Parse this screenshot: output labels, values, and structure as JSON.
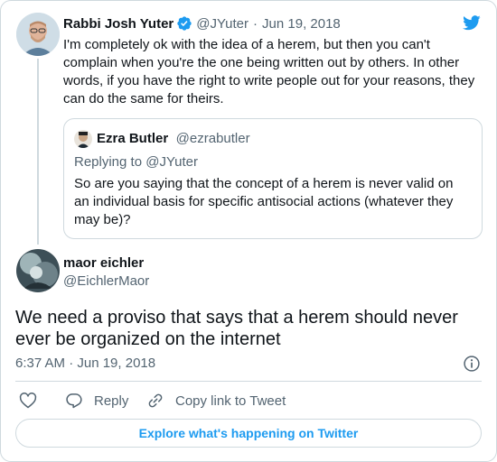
{
  "parent_tweet": {
    "author_name": "Rabbi Josh Yuter",
    "handle": "@JYuter",
    "separator": "·",
    "date": "Jun 19, 2018",
    "text": "I'm completely ok with the idea of a herem, but then you can't complain when you're the one being written out by others. In other words, if you have the right to write people out for your reasons, they can do the same for theirs."
  },
  "quoted_tweet": {
    "author_name": "Ezra Butler",
    "handle": "@ezrabutler",
    "replying_to": "Replying to @JYuter",
    "text": "So are you saying that the concept of a herem is never valid on an individual basis for specific antisocial actions (whatever they may be)?"
  },
  "main_tweet": {
    "author_name": "maor eichler",
    "handle": "@EichlerMaor",
    "text": "We need a proviso that says that a herem should never ever be organized on the internet",
    "timestamp": "6:37 AM · Jun 19, 2018"
  },
  "actions": {
    "reply_label": "Reply",
    "copy_label": "Copy link to Tweet"
  },
  "footer": {
    "explore_label": "Explore what's happening on Twitter"
  },
  "colors": {
    "brand": "#1d9bf0",
    "text": "#0f1419",
    "muted": "#536471",
    "border": "#cfd9de"
  },
  "icons": [
    "twitter-bird-icon",
    "verified-badge-icon",
    "info-icon",
    "heart-icon",
    "reply-icon",
    "link-icon"
  ]
}
